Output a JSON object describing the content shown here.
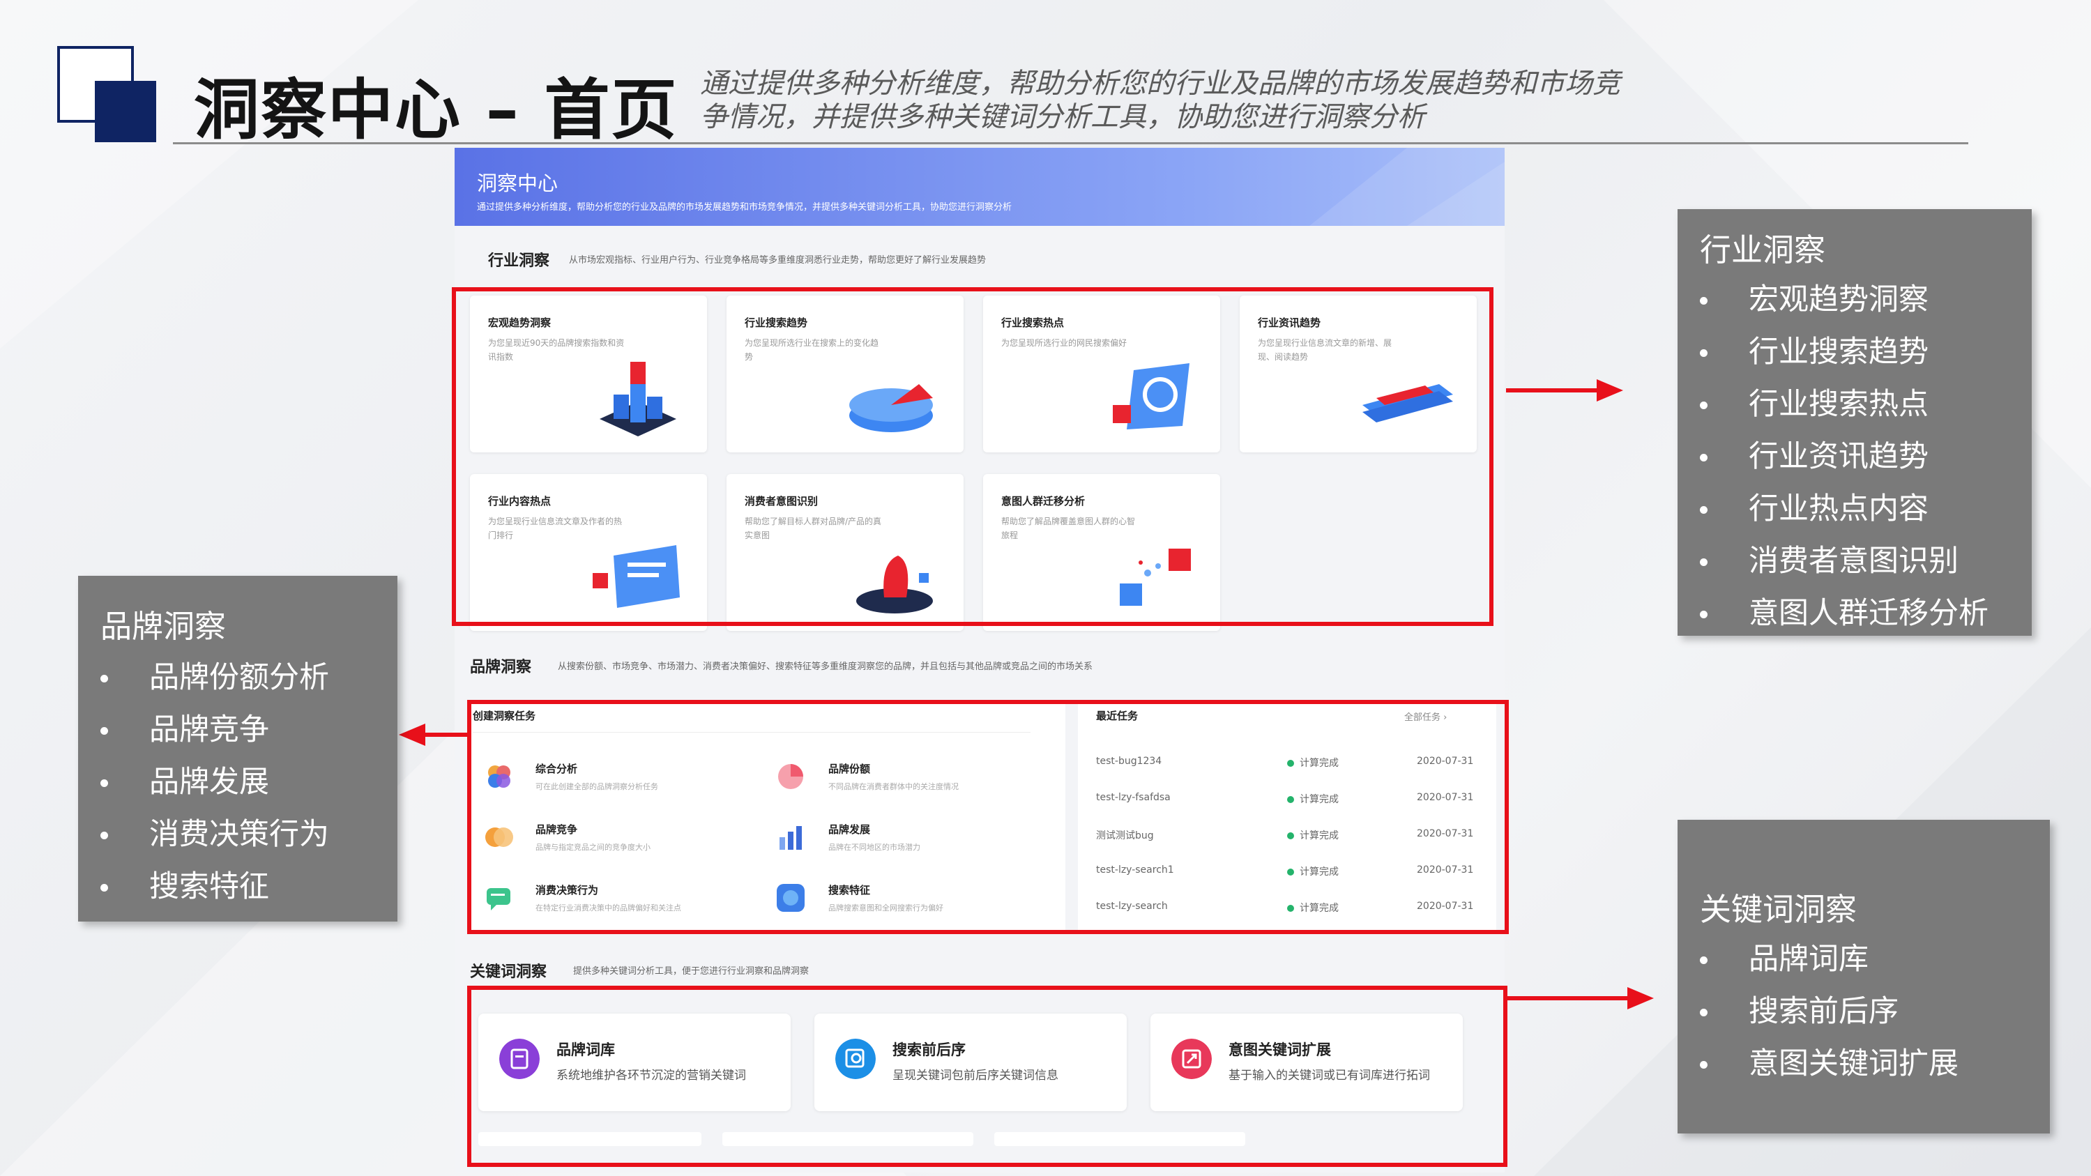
{
  "header": {
    "title": "洞察中心 – 首页",
    "subtitle": "通过提供多种分析维度，帮助分析您的行业及品牌的市场发展趋势和市场竞争情况，并提供多种关键词分析工具，协助您进行洞察分析"
  },
  "screenshot": {
    "banner": {
      "title": "洞察中心",
      "desc": "通过提供多种分析维度，帮助分析您的行业及品牌的市场发展趋势和市场竞争情况，并提供多种关键词分析工具，协助您进行洞察分析"
    },
    "industry": {
      "heading": "行业洞察",
      "desc": "从市场宏观指标、行业用户行为、行业竞争格局等多重维度洞悉行业走势，帮助您更好了解行业发展趋势",
      "tiles": [
        {
          "title": "宏观趋势洞察",
          "desc": "为您呈现近90天的品牌搜索指数和资讯指数",
          "icon": "cube-bars-icon"
        },
        {
          "title": "行业搜索趋势",
          "desc": "为您呈现所选行业在搜索上的变化趋势",
          "icon": "pie-chart-icon"
        },
        {
          "title": "行业搜索热点",
          "desc": "为您呈现所选行业的网民搜索偏好",
          "icon": "magnifier-doc-icon"
        },
        {
          "title": "行业资讯趋势",
          "desc": "为您呈现行业信息流文章的新增、展现、阅读趋势",
          "icon": "bar-blocks-icon"
        },
        {
          "title": "行业内容热点",
          "desc": "为您呈现行业信息流文章及作者的热门排行",
          "icon": "document-board-icon"
        },
        {
          "title": "消费者意图识别",
          "desc": "帮助您了解目标人群对品牌/产品的真实意图",
          "icon": "person-stand-icon"
        },
        {
          "title": "意图人群迁移分析",
          "desc": "帮助您了解品牌覆盖意图人群的心智旅程",
          "icon": "migration-cubes-icon"
        }
      ]
    },
    "brand": {
      "heading": "品牌洞察",
      "desc": "从搜索份额、市场竞争、市场潜力、消费者决策偏好、搜索特征等多重维度洞察您的品牌，并且包括与其他品牌或竞品之间的市场关系",
      "create_title": "创建洞察任务",
      "tasks": [
        {
          "title": "综合分析",
          "desc": "可在此创建全部的品牌洞察分析任务",
          "icon": "flower-icon",
          "color": "#e96a6a"
        },
        {
          "title": "品牌份额",
          "desc": "不同品牌在消费者群体中的关注度情况",
          "icon": "pie-icon",
          "color": "#f05a6e"
        },
        {
          "title": "品牌竞争",
          "desc": "品牌与指定竞品之间的竞争度大小",
          "icon": "overlap-circles-icon",
          "color": "#f4a03c"
        },
        {
          "title": "品牌发展",
          "desc": "品牌在不同地区的市场潜力",
          "icon": "bar-chart-icon",
          "color": "#3c6bd8"
        },
        {
          "title": "消费决策行为",
          "desc": "在特定行业消费决策中的品牌偏好和关注点",
          "icon": "chat-bubble-icon",
          "color": "#3cc48c"
        },
        {
          "title": "搜索特征",
          "desc": "品牌搜索意图和全网搜索行为偏好",
          "icon": "search-circle-icon",
          "color": "#3c7ee8"
        }
      ],
      "recent_title": "最近任务",
      "all_tasks": "全部任务 ›",
      "recent": [
        {
          "name": "test-bug1234",
          "status": "计算完成",
          "date": "2020-07-31"
        },
        {
          "name": "test-lzy-fsafdsa",
          "status": "计算完成",
          "date": "2020-07-31"
        },
        {
          "name": "测试测试bug",
          "status": "计算完成",
          "date": "2020-07-31"
        },
        {
          "name": "test-lzy-search1",
          "status": "计算完成",
          "date": "2020-07-31"
        },
        {
          "name": "test-lzy-search",
          "status": "计算完成",
          "date": "2020-07-31"
        }
      ]
    },
    "keyword": {
      "heading": "关键词洞察",
      "desc": "提供多种关键词分析工具，便于您进行行业洞察和品牌洞察",
      "cards": [
        {
          "title": "品牌词库",
          "desc": "系统地维护各环节沉淀的营销关键词",
          "icon": "library-icon",
          "color": "#8a3fd8"
        },
        {
          "title": "搜索前后序",
          "desc": "呈现关键词包前后序关键词信息",
          "icon": "sequence-icon",
          "color": "#1c8fe6"
        },
        {
          "title": "意图关键词扩展",
          "desc": "基于输入的关键词或已有词库进行拓词",
          "icon": "expand-icon",
          "color": "#e8385a"
        }
      ]
    }
  },
  "callouts": {
    "industry": {
      "title": "行业洞察",
      "items": [
        "宏观趋势洞察",
        "行业搜索趋势",
        "行业搜索热点",
        "行业资讯趋势",
        "行业热点内容",
        "消费者意图识别",
        "意图人群迁移分析"
      ]
    },
    "brand": {
      "title": "品牌洞察",
      "items": [
        "品牌份额分析",
        "品牌竞争",
        "品牌发展",
        "消费决策行为",
        "搜索特征"
      ]
    },
    "keyword": {
      "title": "关键词洞察",
      "items": [
        "品牌词库",
        "搜索前后序",
        "意图关键词扩展"
      ]
    }
  },
  "colors": {
    "accent_red": "#e8101a",
    "navy": "#0f2463",
    "callout_gray": "#7a7a7a"
  }
}
